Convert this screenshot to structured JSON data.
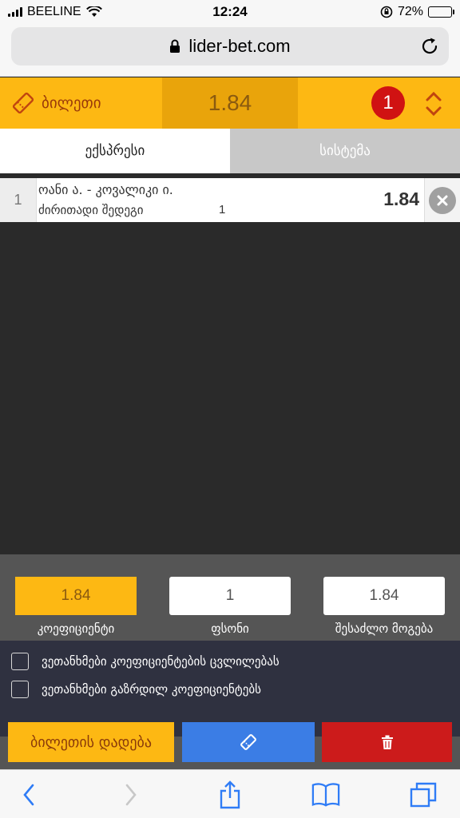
{
  "status_bar": {
    "carrier": "BEELINE",
    "time": "12:24",
    "battery": "72%",
    "battery_level": 0.72
  },
  "browser": {
    "url": "lider-bet.com"
  },
  "ticket": {
    "title": "ბილეთი",
    "total_odd": "1.84",
    "count": "1"
  },
  "tabs": [
    {
      "label": "ექსპრესი",
      "active": true
    },
    {
      "label": "სისტემა",
      "active": false
    }
  ],
  "bets": [
    {
      "index": "1",
      "match": "ოანი ა. - კოვალიკი ი.",
      "market": "ძირითადი შედეგი",
      "outcome": "1",
      "odd": "1.84"
    }
  ],
  "summary": {
    "coefficient_value": "1.84",
    "coefficient_label": "კოეფიციენტი",
    "stake_value": "1",
    "stake_label": "ფსონი",
    "payout_value": "1.84",
    "payout_label": "შესაძლო მოგება"
  },
  "options": [
    {
      "label": "ვეთანხმები კოეფიციენტების ცვლილებას",
      "checked": false
    },
    {
      "label": "ვეთანხმები გაზრდილ კოეფიციენტებს",
      "checked": false
    }
  ],
  "actions": {
    "place_label": "ბილეთის დადება"
  },
  "icons": {
    "ticket": "ticket-icon",
    "trash": "trash-icon",
    "remove": "close-icon",
    "reorder": "chevron-updown-icon"
  },
  "colors": {
    "accent_yellow": "#fdb813",
    "badge_red": "#d01212",
    "action_blue": "#3b7de5",
    "delete_red": "#cc1b1b"
  }
}
